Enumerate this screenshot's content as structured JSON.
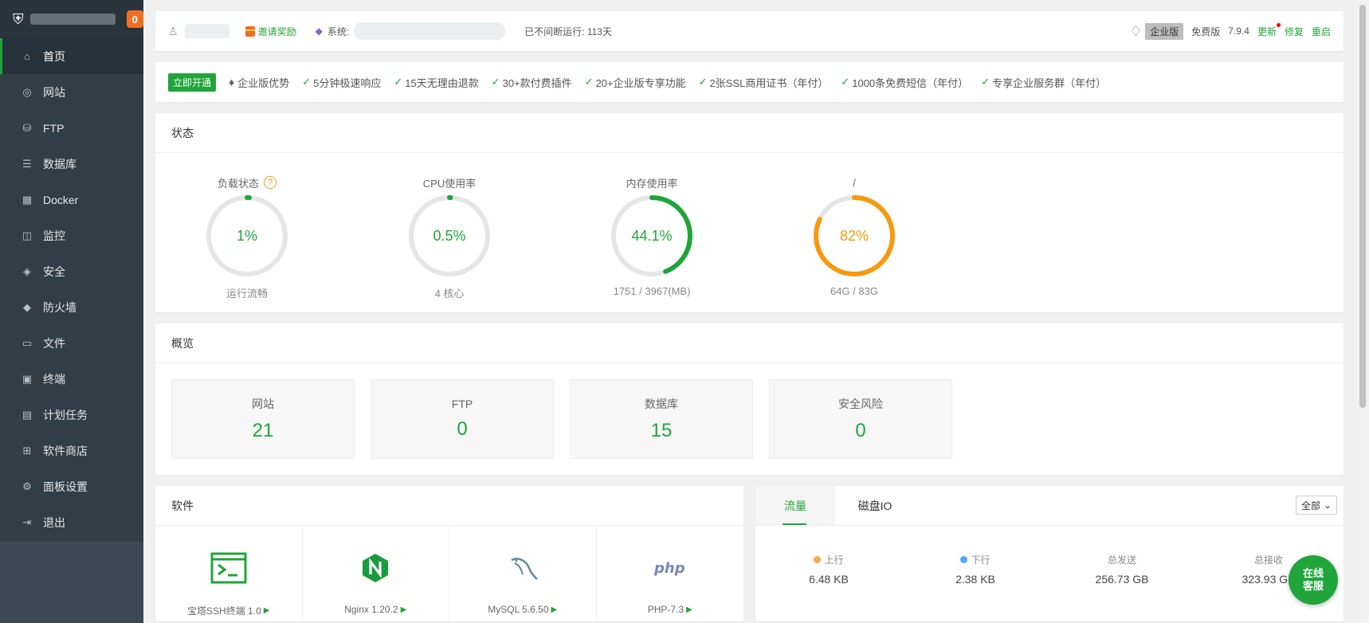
{
  "sidebar": {
    "badge": "0",
    "items": [
      {
        "label": "首页",
        "icon": "home-icon",
        "glyph": "⌂"
      },
      {
        "label": "网站",
        "icon": "globe-icon",
        "glyph": "◎"
      },
      {
        "label": "FTP",
        "icon": "ftp-icon",
        "glyph": "⛁"
      },
      {
        "label": "数据库",
        "icon": "database-icon",
        "glyph": "☰"
      },
      {
        "label": "Docker",
        "icon": "docker-icon",
        "glyph": "▦"
      },
      {
        "label": "监控",
        "icon": "monitor-icon",
        "glyph": "◫"
      },
      {
        "label": "安全",
        "icon": "shield-icon",
        "glyph": "◈"
      },
      {
        "label": "防火墙",
        "icon": "firewall-icon",
        "glyph": "◆"
      },
      {
        "label": "文件",
        "icon": "folder-icon",
        "glyph": "▭"
      },
      {
        "label": "终端",
        "icon": "terminal-icon",
        "glyph": "▣"
      },
      {
        "label": "计划任务",
        "icon": "calendar-icon",
        "glyph": "▤"
      },
      {
        "label": "软件商店",
        "icon": "apps-icon",
        "glyph": "⊞"
      },
      {
        "label": "面板设置",
        "icon": "gear-icon",
        "glyph": "⚙"
      },
      {
        "label": "退出",
        "icon": "logout-icon",
        "glyph": "⇥"
      }
    ]
  },
  "topbar": {
    "invite": "邀请奖励",
    "system_label": "系统:",
    "uptime": "已不间断运行: 113天",
    "edition": "企业版",
    "free_label": "免费版",
    "version": "7.9.4",
    "update": "更新",
    "repair": "修复",
    "restart": "重启"
  },
  "promo": {
    "open_button": "立即开通",
    "advantage": "企业版优势",
    "features": [
      "5分钟极速响应",
      "15天无理由退款",
      "30+款付费插件",
      "20+企业版专享功能",
      "2张SSL商用证书（年付）",
      "1000条免费短信（年付）",
      "专享企业服务群（年付）"
    ]
  },
  "status": {
    "title": "状态",
    "gauges": [
      {
        "title": "负载状态",
        "value": "1%",
        "percent": 1,
        "sub": "运行流畅",
        "color": "#20a53a",
        "help": "?"
      },
      {
        "title": "CPU使用率",
        "value": "0.5%",
        "percent": 0.5,
        "sub": "4 核心",
        "color": "#20a53a"
      },
      {
        "title": "内存使用率",
        "value": "44.1%",
        "percent": 44.1,
        "sub": "1751 / 3967(MB)",
        "color": "#20a53a"
      },
      {
        "title": "/",
        "value": "82%",
        "percent": 82,
        "sub": "64G / 83G",
        "color": "#f7990c"
      }
    ]
  },
  "overview": {
    "title": "概览",
    "items": [
      {
        "label": "网站",
        "value": "21"
      },
      {
        "label": "FTP",
        "value": "0"
      },
      {
        "label": "数据库",
        "value": "15"
      },
      {
        "label": "安全风险",
        "value": "0"
      }
    ]
  },
  "software": {
    "title": "软件",
    "items": [
      {
        "name": "宝塔SSH终端 1.0",
        "icon": "terminal-app-icon"
      },
      {
        "name": "Nginx 1.20.2",
        "icon": "nginx-icon"
      },
      {
        "name": "MySQL 5.6.50",
        "icon": "mysql-icon"
      },
      {
        "name": "PHP-7.3",
        "icon": "php-icon"
      }
    ]
  },
  "traffic": {
    "tabs": [
      "流量",
      "磁盘IO"
    ],
    "select": "全部",
    "stats": [
      {
        "label": "上行",
        "value": "6.48 KB",
        "dot": "#f0ad4e"
      },
      {
        "label": "下行",
        "value": "2.38 KB",
        "dot": "#52a9ff"
      },
      {
        "label": "总发送",
        "value": "256.73 GB"
      },
      {
        "label": "总接收",
        "value": "323.93 GB"
      }
    ]
  },
  "support": {
    "line1": "在线",
    "line2": "客服"
  }
}
